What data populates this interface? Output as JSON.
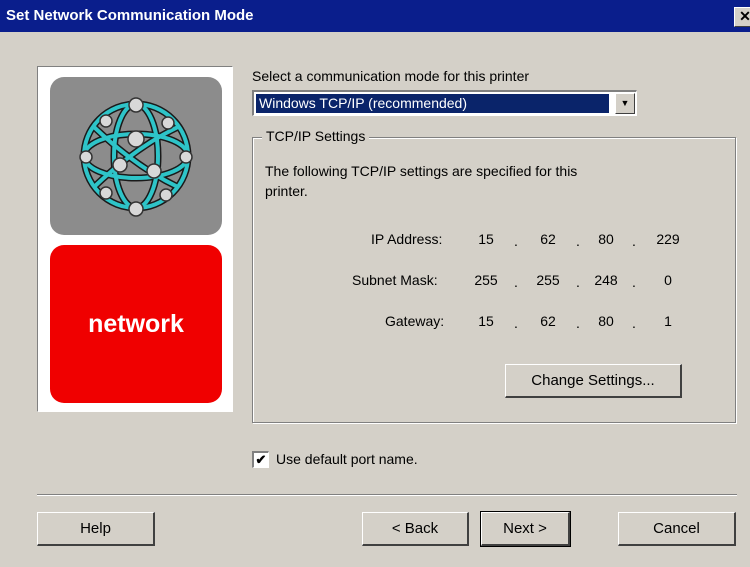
{
  "window": {
    "title": "Set Network Communication Mode",
    "close_glyph": "✕"
  },
  "logo": {
    "icon": "network-globe-icon",
    "label": "network",
    "colors": {
      "top": "#8c8c8c",
      "bottom": "#f00000",
      "globe": "#2ec4c8"
    }
  },
  "mode": {
    "label": "Select a communication mode for this printer",
    "selected": "Windows TCP/IP  (recommended)",
    "arrow": "▼"
  },
  "tcpip": {
    "group_title": "TCP/IP Settings",
    "description_line1": "The following TCP/IP settings are specified for this",
    "description_line2": "printer.",
    "ip_label": "IP Address:",
    "ip": [
      "15",
      "62",
      "80",
      "229"
    ],
    "subnet_label": "Subnet Mask:",
    "subnet": [
      "255",
      "255",
      "248",
      "0"
    ],
    "gateway_label": "Gateway:",
    "gateway": [
      "15",
      "62",
      "80",
      "1"
    ],
    "dot": ".",
    "change_button": "Change Settings..."
  },
  "port": {
    "checked": true,
    "check_glyph": "✔",
    "label": "Use default port name."
  },
  "buttons": {
    "help": "Help",
    "back": "< Back",
    "next": "Next >",
    "cancel": "Cancel"
  },
  "colors": {
    "titlebar": "#0a1e8c",
    "dialog_bg": "#d4d0c8",
    "selection": "#0a246a"
  }
}
